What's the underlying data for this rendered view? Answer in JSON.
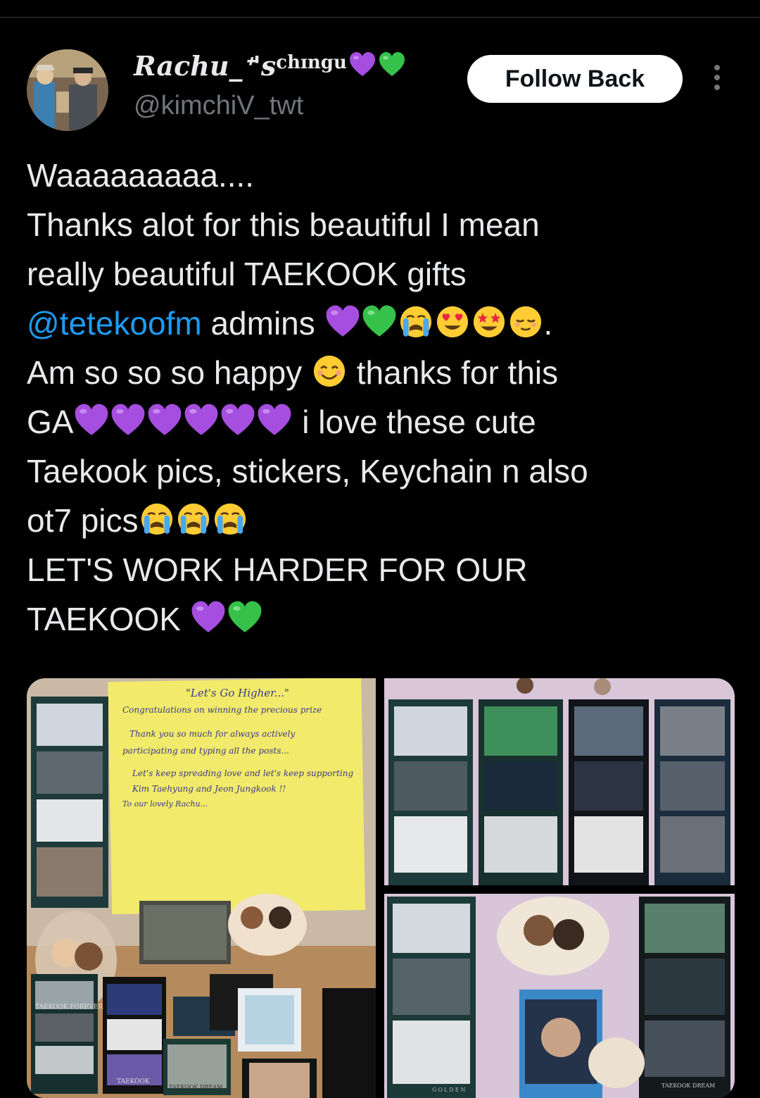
{
  "user": {
    "display_name": "Rachu_",
    "name_symbol": "ᕀ's",
    "name_sup": "chɪngu",
    "handle": "@kimchiV_twt"
  },
  "actions": {
    "follow_label": "Follow Back"
  },
  "tweet": {
    "line1": "Waaaaaaaaa....",
    "line2": "Thanks alot for this beautiful I mean",
    "line3": "really beautiful TAEKOOK gifts",
    "mention": "@tetekoofm",
    "line4_rest": " admins ",
    "line5a": "Am so so so happy ",
    "line5b": " thanks for this",
    "line6a": "GA",
    "line6b": " i love these cute",
    "line7": "Taekook pics, stickers, Keychain n also",
    "line8": "ot7 pics",
    "line9": "LET'S WORK HARDER FOR OUR",
    "line10": "TAEKOOK "
  },
  "media": {
    "note_title": "\"Let's Go Higher...\"",
    "note_lines": [
      "Congratulations on winning the precious prize",
      "Thank you so much for always actively",
      "participating and typing all the posts...",
      "Let's keep spreading love and let's keep supporting",
      "Kim Taehyung and Jeon Jungkook !!",
      "To our lovely Rachu..."
    ],
    "card_labels": [
      "TAEKOOK FOREVER",
      "TAEKOOK",
      "TAEKOOK DREAM",
      "TAEKOOK DREAM",
      "GOLDEN"
    ]
  },
  "colors": {
    "background": "#000000",
    "text": "#e7e9ea",
    "muted": "#71767b",
    "link": "#1d9bf0",
    "purple_heart": "#a64ee0",
    "green_heart": "#36c24a"
  },
  "icons": [
    "purple-heart-icon",
    "green-heart-icon",
    "crying-face-icon",
    "heart-eyes-icon",
    "star-struck-icon",
    "relieved-face-icon",
    "smiling-face-icon",
    "more-options-icon"
  ]
}
